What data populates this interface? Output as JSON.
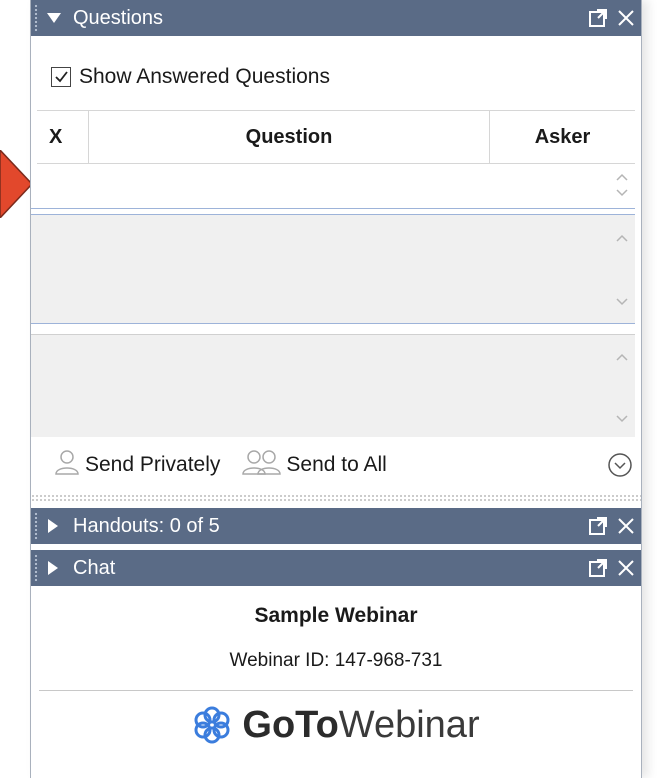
{
  "questions_panel": {
    "title": "Questions",
    "show_answered_label": "Show Answered Questions",
    "show_answered_checked": true,
    "columns": [
      "X",
      "Question",
      "Asker"
    ],
    "send_privately_label": "Send Privately",
    "send_to_all_label": "Send to All"
  },
  "handouts_panel": {
    "title": "Handouts: 0 of 5"
  },
  "chat_panel": {
    "title": "Chat"
  },
  "webinar": {
    "name": "Sample Webinar",
    "id_text": "Webinar ID: 147-968-731",
    "logo_bold": "GoTo",
    "logo_light": "Webinar"
  },
  "colors": {
    "title_bar": "#5a6b86",
    "field_border": "#9db3d9",
    "arrow": "#e2482c",
    "logo_blue": "#3b7ddd"
  }
}
